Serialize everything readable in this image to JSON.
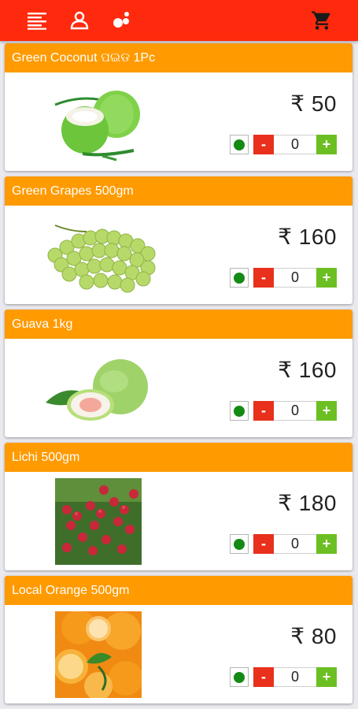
{
  "topbar": {
    "icons": [
      "menu-icon",
      "user-icon",
      "group-icon",
      "cart-icon"
    ],
    "color": "#ff2a0d"
  },
  "colors": {
    "title_bar": "#ff9a00",
    "minus": "#e8301c",
    "plus": "#6cbf22",
    "veg": "#138a13"
  },
  "products": [
    {
      "title": "Green Coconut ପଇଡ 1Pc",
      "price": "₹ 50",
      "qty": "0",
      "minus": "-",
      "plus": "+",
      "image": "coconut"
    },
    {
      "title": "Green Grapes 500gm",
      "price": "₹ 160",
      "qty": "0",
      "minus": "-",
      "plus": "+",
      "image": "grapes"
    },
    {
      "title": "Guava 1kg",
      "price": "₹ 160",
      "qty": "0",
      "minus": "-",
      "plus": "+",
      "image": "guava"
    },
    {
      "title": "Lichi 500gm",
      "price": "₹ 180",
      "qty": "0",
      "minus": "-",
      "plus": "+",
      "image": "lichi"
    },
    {
      "title": "Local Orange 500gm",
      "price": "₹ 80",
      "qty": "0",
      "minus": "-",
      "plus": "+",
      "image": "orange"
    }
  ]
}
